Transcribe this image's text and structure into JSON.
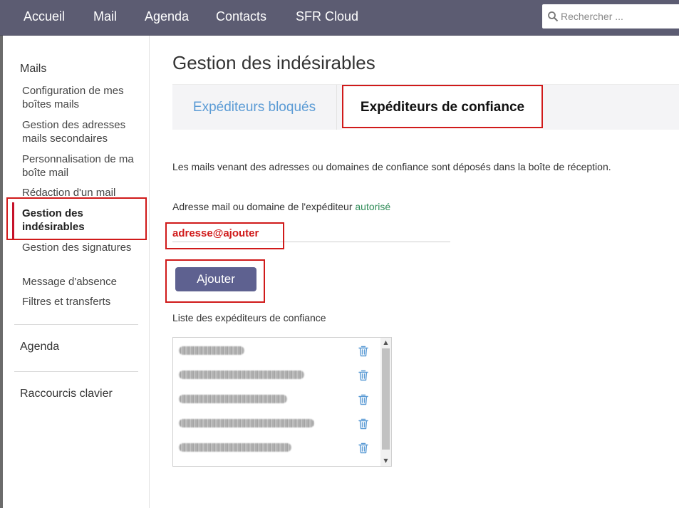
{
  "nav": {
    "items": [
      {
        "label": "Accueil"
      },
      {
        "label": "Mail"
      },
      {
        "label": "Agenda"
      },
      {
        "label": "Contacts"
      },
      {
        "label": "SFR Cloud"
      }
    ],
    "search_placeholder": "Rechercher ..."
  },
  "sidebar": {
    "section_mails": "Mails",
    "items": [
      {
        "label": "Configuration de mes boîtes mails"
      },
      {
        "label": "Gestion des adresses mails secondaires"
      },
      {
        "label": "Personnalisation de ma boîte mail"
      },
      {
        "label": "Rédaction d'un mail"
      },
      {
        "label": "Gestion des indésirables"
      },
      {
        "label": "Gestion des signatures"
      },
      {
        "label": "Message d'absence"
      },
      {
        "label": "Filtres et transferts"
      }
    ],
    "active_item": "Gestion des indésirables",
    "section_agenda": "Agenda",
    "section_shortcuts": "Raccourcis clavier"
  },
  "main": {
    "title": "Gestion des indésirables",
    "tabs": [
      {
        "label": "Expéditeurs bloqués"
      },
      {
        "label": "Expéditeurs de confiance"
      }
    ],
    "active_tab": "Expéditeurs de confiance",
    "description": "Les mails venant des adresses ou domaines de confiance sont déposés dans la boîte de réception.",
    "field_label": "Adresse mail ou domaine de l'expéditeur",
    "field_label_accent": "autorisé",
    "address_value": "adresse@ajouter",
    "add_button": "Ajouter",
    "list_label": "Liste des expéditeurs de confiance",
    "list_entries": [
      {
        "text": "",
        "delete_icon": "trash-icon"
      },
      {
        "text": "",
        "delete_icon": "trash-icon"
      },
      {
        "text": "",
        "delete_icon": "trash-icon"
      },
      {
        "text": "",
        "delete_icon": "trash-icon"
      },
      {
        "text": "",
        "delete_icon": "trash-icon"
      }
    ]
  },
  "colors": {
    "topbar": "#5c5c72",
    "highlight": "#d01a1a",
    "active_bar": "#c6122a",
    "tab_inactive_text": "#5b9bd5",
    "button": "#5e6190",
    "accent_green": "#2e8b57",
    "trash_icon": "#5b9bd5"
  }
}
